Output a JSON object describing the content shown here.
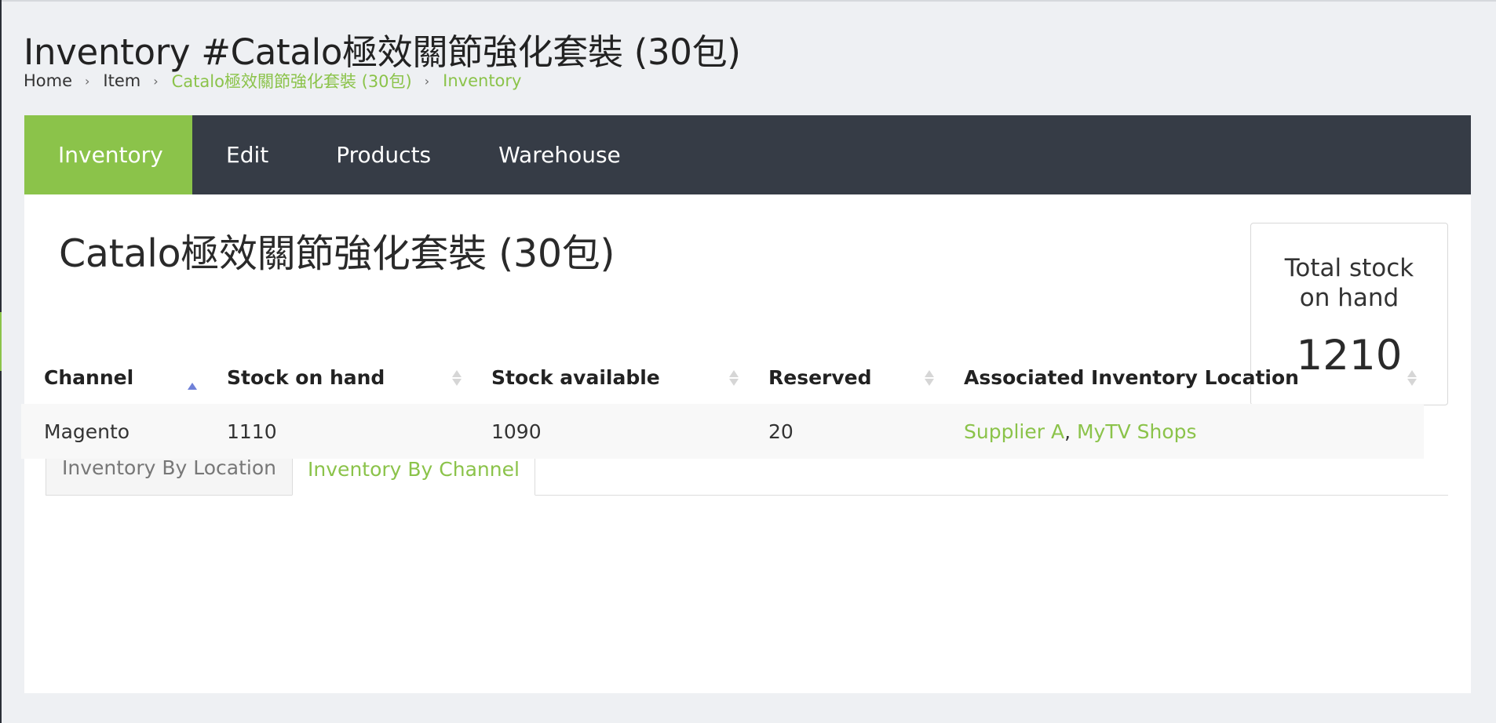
{
  "page": {
    "title": "Inventory #Catalo極效關節強化套裝 (30包)"
  },
  "breadcrumb": [
    {
      "label": "Home"
    },
    {
      "label": "Item"
    },
    {
      "label": "Catalo極效關節強化套裝 (30包)"
    },
    {
      "label": "Inventory"
    }
  ],
  "nav_tabs": [
    {
      "label": "Inventory",
      "active": true
    },
    {
      "label": "Edit"
    },
    {
      "label": "Products"
    },
    {
      "label": "Warehouse"
    }
  ],
  "item": {
    "name": "Catalo極效關節強化套裝 (30包)"
  },
  "stock_card": {
    "label": "Total stock on hand",
    "value": "1210"
  },
  "sub_tabs": [
    {
      "label": "Inventory By Location"
    },
    {
      "label": "Inventory By Channel",
      "active": true
    }
  ],
  "table": {
    "columns": [
      "Channel",
      "Stock on hand",
      "Stock available",
      "Reserved",
      "Associated Inventory Location"
    ],
    "rows": [
      {
        "channel": "Magento",
        "stock_on_hand": "1110",
        "stock_available": "1090",
        "reserved": "20",
        "locations": [
          "Supplier A",
          "MyTV Shops"
        ],
        "separator": ", "
      }
    ]
  },
  "colors": {
    "accent": "#8bc34a",
    "navbar": "#363c46",
    "sort_active": "#6f80d8"
  }
}
